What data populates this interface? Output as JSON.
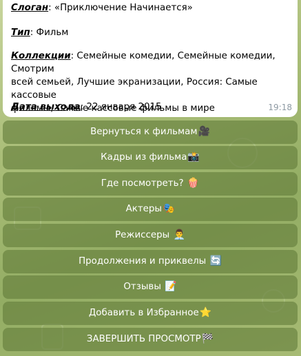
{
  "message": {
    "slogan_label": "Слоган",
    "slogan_value": ": «Приключение Начинается»",
    "type_label": "Тип",
    "type_value": ": Фильм",
    "collections_label": "Коллекции",
    "collections_line1": ": Семейные комедии, Семейные комедии, Смотрим",
    "collections_line2": "всей семьей, Лучшие экранизации, Россия: Самые кассовые",
    "collections_line3": "фильмы, Самые кассовые фильмы в мире",
    "release_label": "Дата выхода",
    "release_value": ": 22 января 2015",
    "time": "19:18"
  },
  "keyboard": {
    "buttons": [
      {
        "label": "Вернуться к фильмам",
        "icon": "movie-camera-icon",
        "glyph": "🎥"
      },
      {
        "label": "Кадры из фильма",
        "icon": "camera-flash-icon",
        "glyph": "📸"
      },
      {
        "label": "Где посмотреть? ",
        "icon": "popcorn-icon",
        "glyph": "🍿"
      },
      {
        "label": "Актеры",
        "icon": "theater-masks-icon",
        "glyph": "🎭"
      },
      {
        "label": "Режиссеры ",
        "icon": "man-technologist-icon",
        "glyph": "👨‍💼"
      },
      {
        "label": "Продолжения и приквелы ",
        "icon": "refresh-arrows-icon",
        "glyph": "🔄"
      },
      {
        "label": "Отзывы ",
        "icon": "memo-icon",
        "glyph": "📝"
      },
      {
        "label": "Добавить в Избранное",
        "icon": "star-icon",
        "glyph": "⭐"
      },
      {
        "label": "ЗАВЕРШИТЬ ПРОСМОТР",
        "icon": "checkered-flag-icon",
        "glyph": "🏁"
      }
    ]
  }
}
